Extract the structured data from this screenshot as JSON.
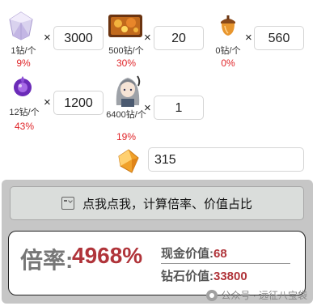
{
  "items": [
    {
      "icon": "diamond-icon",
      "price": "1钻/个",
      "pct": "9%",
      "multiplier": "×",
      "qty": "3000"
    },
    {
      "icon": "treasure-chest-icon",
      "price": "500钻/个",
      "pct": "30%",
      "multiplier": "×",
      "qty": "20"
    },
    {
      "icon": "acorn-icon",
      "price": "0钻/个",
      "pct": "0%",
      "multiplier": "×",
      "qty": "560"
    },
    {
      "icon": "purple-spirit-icon",
      "price": "12钻/个",
      "pct": "43%",
      "multiplier": "×",
      "qty": "1200"
    },
    {
      "icon": "character-portrait-icon",
      "price": "6400钻/个",
      "pct": "19%",
      "multiplier": "×",
      "qty": "1"
    }
  ],
  "gem_input": {
    "icon": "orange-gem-icon",
    "value": "315"
  },
  "calc_button": {
    "label": "点我点我，计算倍率、价值占比"
  },
  "result": {
    "rate_label": "倍率:",
    "rate_value": "4968%",
    "cash_label": "现金价值:",
    "cash_value": "68",
    "diamond_label": "钻石价值:",
    "diamond_value": "33800"
  },
  "watermark": {
    "text": "公众号 · 远征八宝袋"
  },
  "colors": {
    "accent_red": "#e0262a",
    "value_red": "#b0343a",
    "panel_gray": "#c6c6c6"
  }
}
